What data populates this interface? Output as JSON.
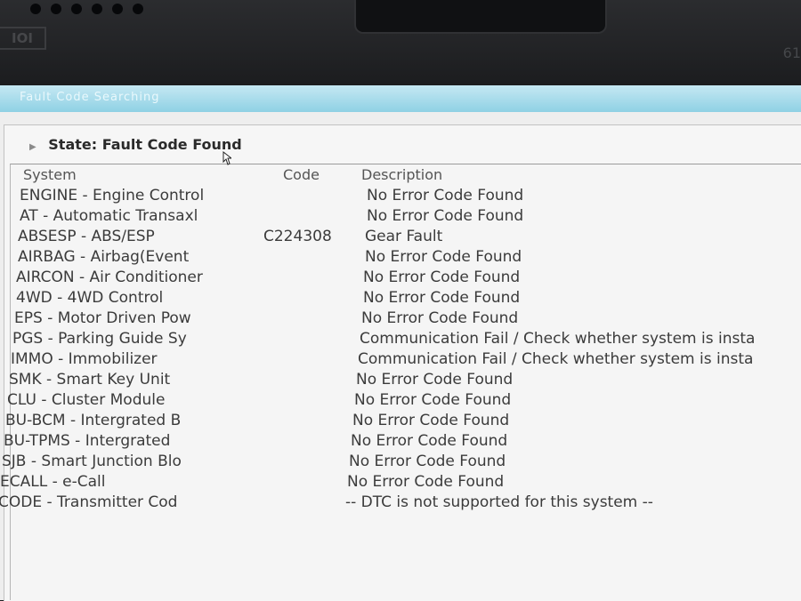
{
  "window": {
    "title": "Fault Code Searching"
  },
  "device": {
    "corner_number": "61",
    "logo_text": "IOI"
  },
  "status": {
    "label": "State:",
    "value": "Fault Code Found"
  },
  "table": {
    "columns": {
      "system": "System",
      "code": "Code",
      "description": "Description"
    },
    "rows": [
      {
        "system": "ENGINE - Engine Control",
        "code": "",
        "description": "No Error Code Found"
      },
      {
        "system": "AT - Automatic Transaxl",
        "code": "",
        "description": "No Error Code Found"
      },
      {
        "system": "ABSESP - ABS/ESP",
        "code": "C224308",
        "description": "Gear Fault"
      },
      {
        "system": "AIRBAG - Airbag(Event",
        "code": "",
        "description": "No Error Code Found"
      },
      {
        "system": "AIRCON - Air Conditioner",
        "code": "",
        "description": "No Error Code Found"
      },
      {
        "system": "4WD - 4WD Control",
        "code": "",
        "description": "No Error Code Found"
      },
      {
        "system": "EPS - Motor Driven Pow",
        "code": "",
        "description": "No Error Code Found"
      },
      {
        "system": "PGS - Parking Guide Sy",
        "code": "",
        "description": "Communication Fail / Check whether system is insta"
      },
      {
        "system": "IMMO - Immobilizer",
        "code": "",
        "description": "Communication Fail / Check whether system is insta"
      },
      {
        "system": "SMK - Smart Key Unit",
        "code": "",
        "description": "No Error Code Found"
      },
      {
        "system": "CLU - Cluster Module",
        "code": "",
        "description": "No Error Code Found"
      },
      {
        "system": "BU-BCM - Intergrated B",
        "code": "",
        "description": "No Error Code Found"
      },
      {
        "system": "BU-TPMS - Intergrated",
        "code": "",
        "description": "No Error Code Found"
      },
      {
        "system": "SJB - Smart Junction Blo",
        "code": "",
        "description": "No Error Code Found"
      },
      {
        "system": "ECALL - e-Call",
        "code": "",
        "description": "No Error Code Found"
      },
      {
        "system": "CODE - Transmitter Cod",
        "code": "",
        "description": "-- DTC is not supported for this system --"
      }
    ]
  }
}
